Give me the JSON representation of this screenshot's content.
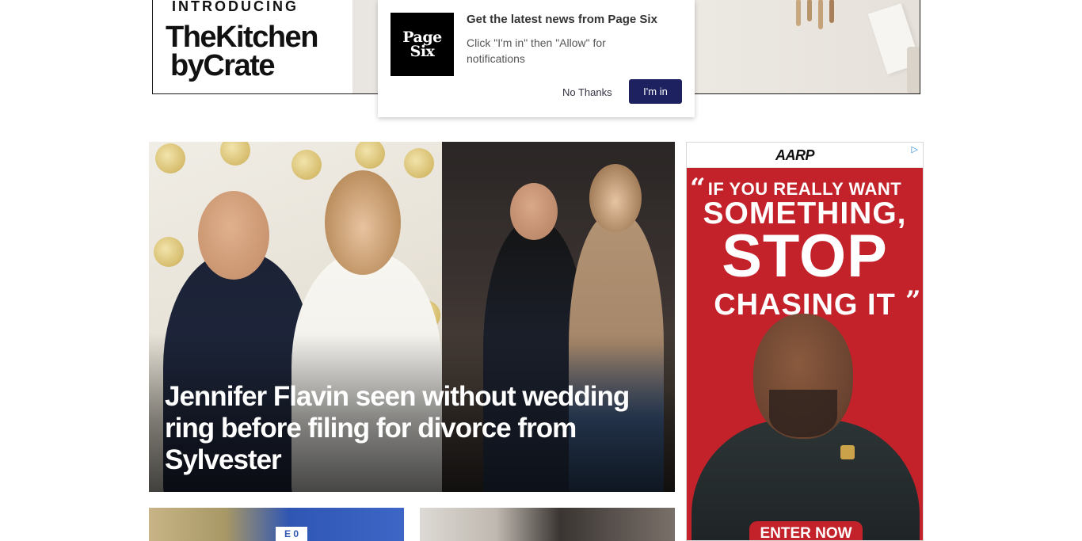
{
  "top_ad": {
    "kicker": "INTRODUCING",
    "brand_line1": "TheKitchen",
    "brand_line2": "byCrate"
  },
  "notification": {
    "logo_line1": "Page",
    "logo_line2": "Six",
    "title": "Get the latest news from Page Six",
    "body": "Click \"I'm in\" then \"Allow\" for notifications",
    "decline_label": "No Thanks",
    "accept_label": "I'm in",
    "accept_color": "#1e2160"
  },
  "hero": {
    "headline": "Jennifer Flavin seen without wedding ring before filing for divorce from Sylvester"
  },
  "thumbs": [
    {
      "tag": "E 0"
    },
    {}
  ],
  "side_ad": {
    "brand": "AARP",
    "adchoice_icon": "adchoices-icon",
    "quote_open": "“",
    "quote_close": "”",
    "line1": "IF YOU REALLY WANT",
    "line2": "SOMETHING,",
    "line3": "STOP",
    "line4": "CHASING IT",
    "cta": "ENTER NOW",
    "bg_color": "#c4222a"
  }
}
